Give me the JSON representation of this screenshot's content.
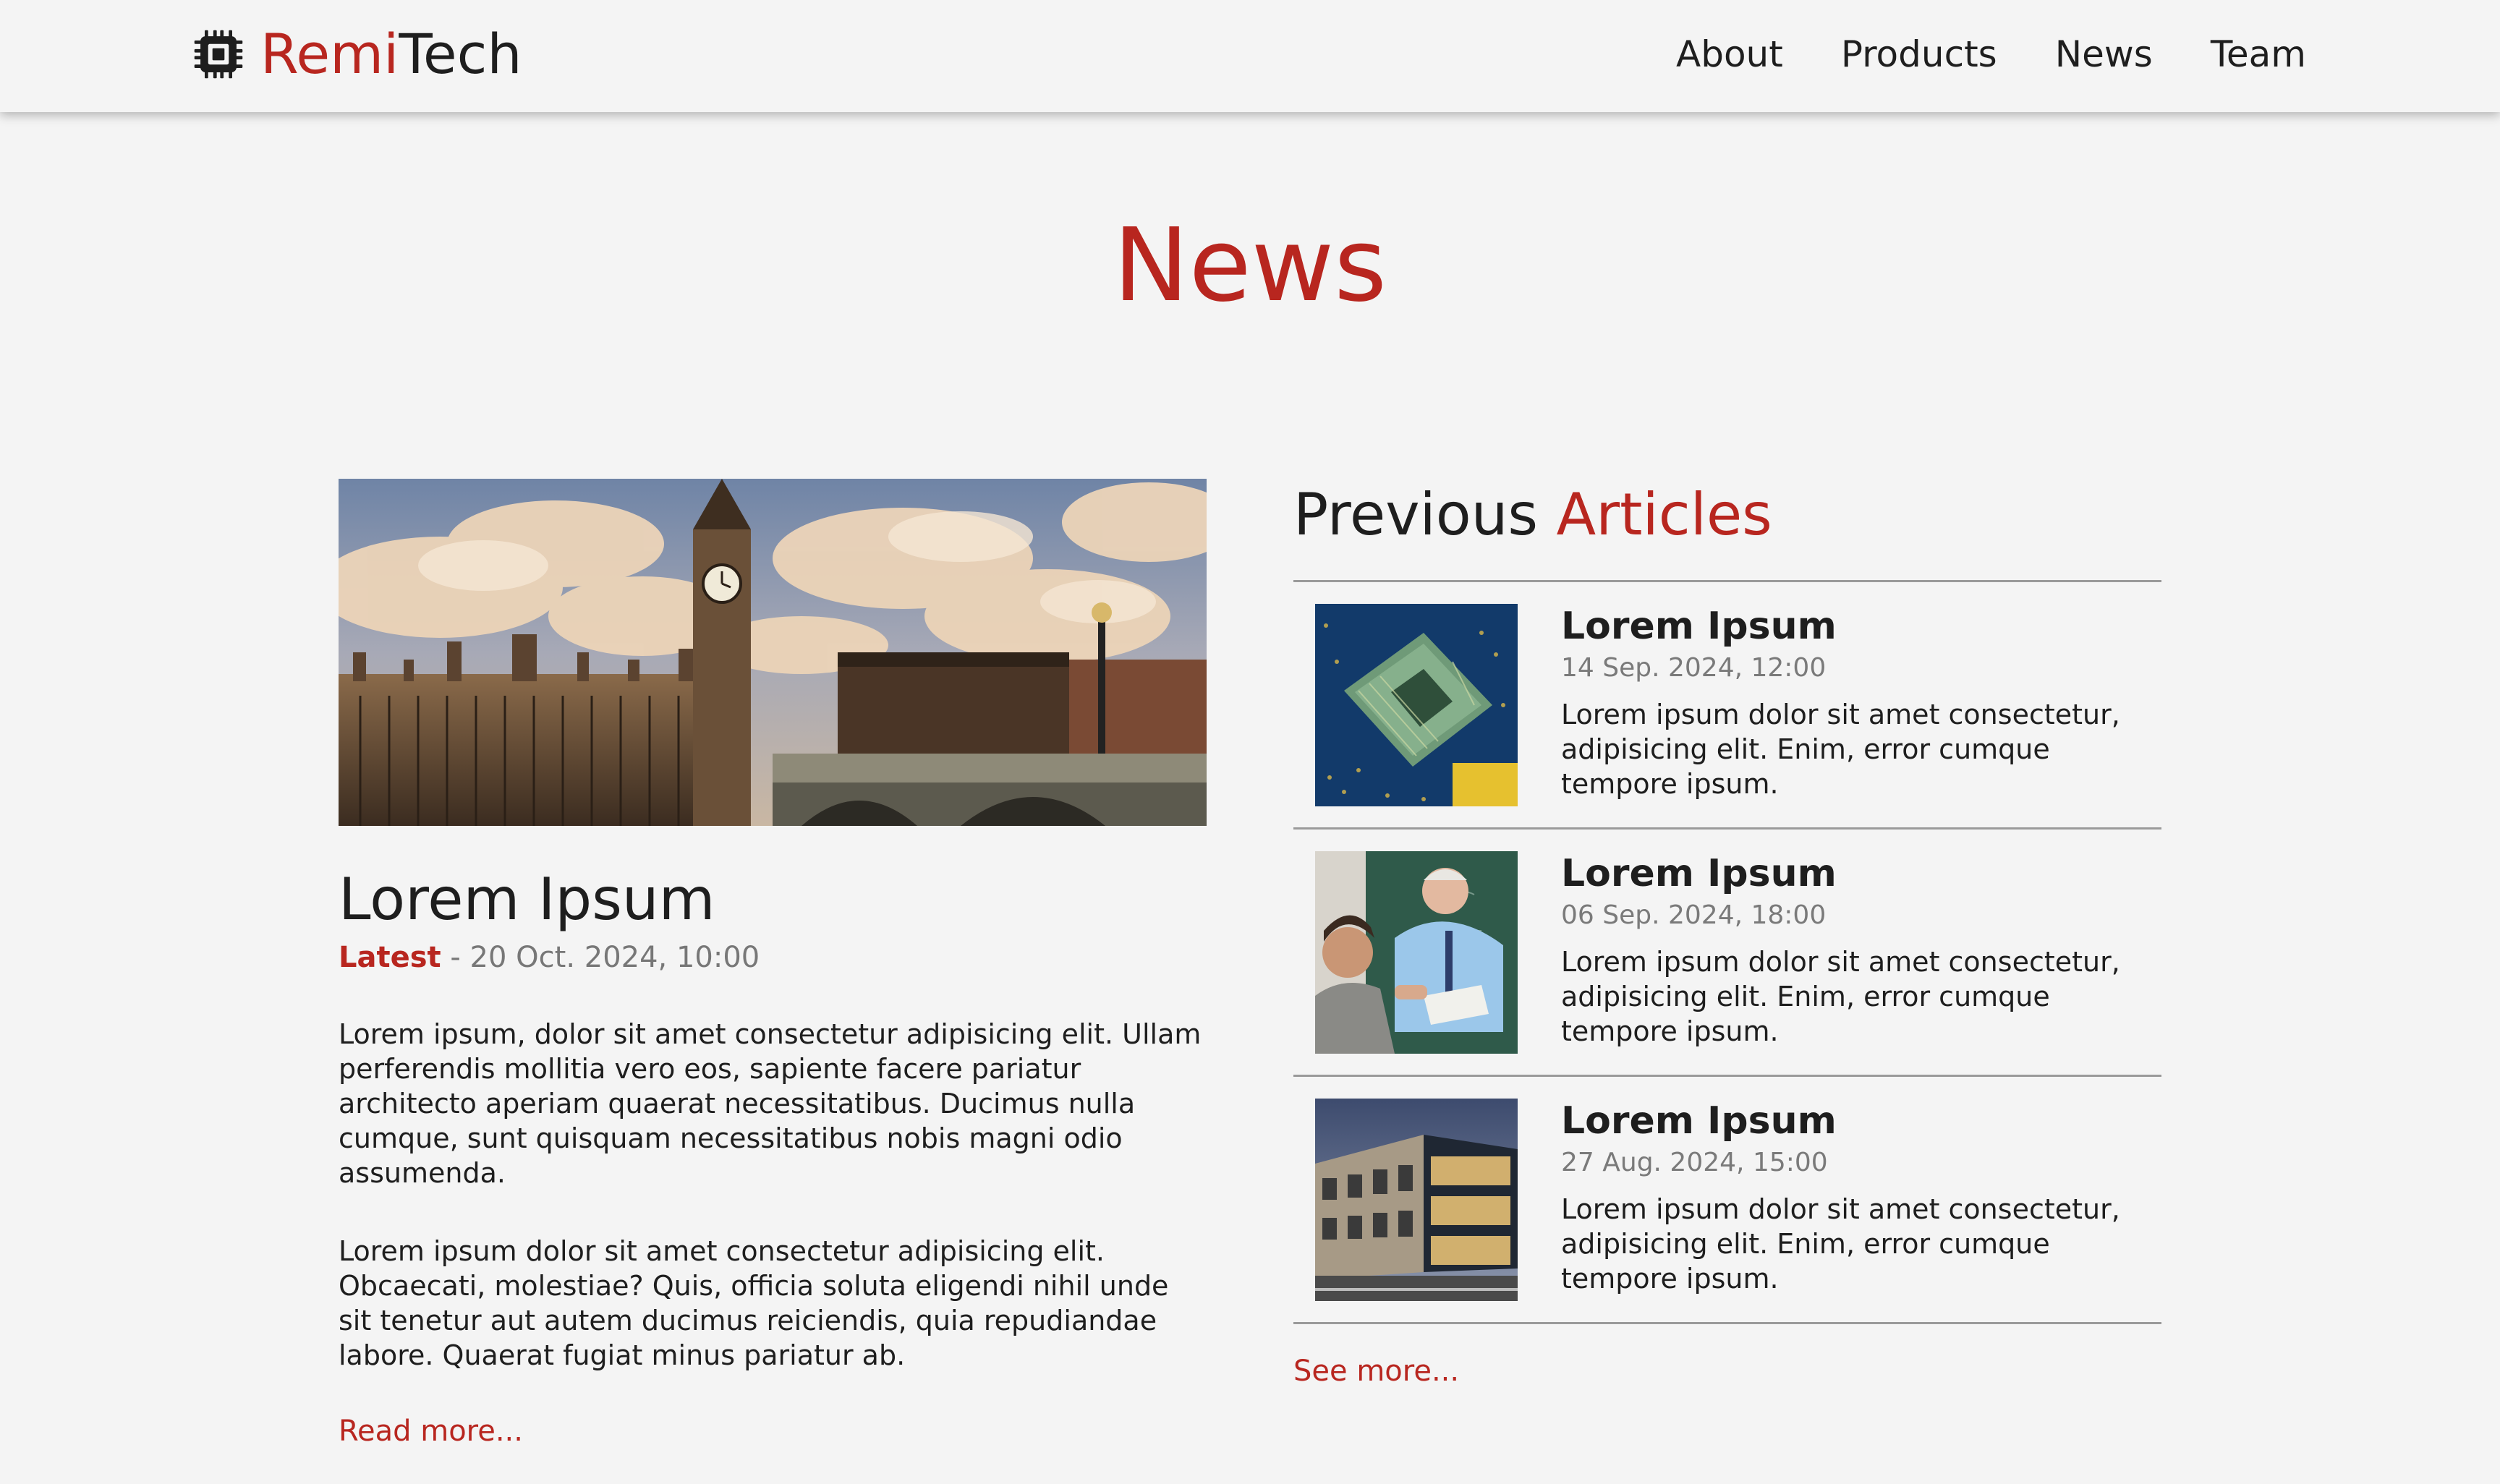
{
  "brand": {
    "name_part1": "Remi",
    "name_part2": "Tech",
    "icon": "cpu-chip-icon",
    "accent_color": "#b8261f"
  },
  "nav": {
    "items": [
      {
        "label": "About"
      },
      {
        "label": "Products"
      },
      {
        "label": "News"
      },
      {
        "label": "Team"
      }
    ]
  },
  "page": {
    "title": "News"
  },
  "featured": {
    "image": "westminster-palace-big-ben-photo",
    "title": "Lorem Ipsum",
    "tag": "Latest",
    "separator": " - ",
    "date": "20 Oct. 2024, 10:00",
    "paragraphs": [
      "Lorem ipsum, dolor sit amet consectetur adipisicing elit. Ullam perferendis mollitia vero eos, sapiente facere pariatur architecto aperiam quaerat necessitatibus. Ducimus nulla cumque, sunt quisquam necessitatibus nobis magni odio assumenda.",
      "Lorem ipsum dolor sit amet consectetur adipisicing elit. Obcaecati, molestiae? Quis, officia soluta eligendi nihil unde sit tenetur aut autem ducimus reiciendis, quia repudiandae labore. Quaerat fugiat minus pariatur ab."
    ],
    "read_more": "Read more..."
  },
  "previous": {
    "heading_part1": "Previous",
    "heading_part2": "Articles",
    "articles": [
      {
        "image": "cpu-processor-photo",
        "title": "Lorem Ipsum",
        "date": "14 Sep. 2024, 12:00",
        "excerpt": "Lorem ipsum dolor sit amet consectetur, adipisicing elit. Enim, error cumque tempore ipsum."
      },
      {
        "image": "teacher-student-photo",
        "title": "Lorem Ipsum",
        "date": "06 Sep. 2024, 18:00",
        "excerpt": "Lorem ipsum dolor sit amet consectetur, adipisicing elit. Enim, error cumque tempore ipsum."
      },
      {
        "image": "office-building-photo",
        "title": "Lorem Ipsum",
        "date": "27 Aug. 2024, 15:00",
        "excerpt": "Lorem ipsum dolor sit amet consectetur, adipisicing elit. Enim, error cumque tempore ipsum."
      }
    ],
    "see_more": "See more..."
  }
}
